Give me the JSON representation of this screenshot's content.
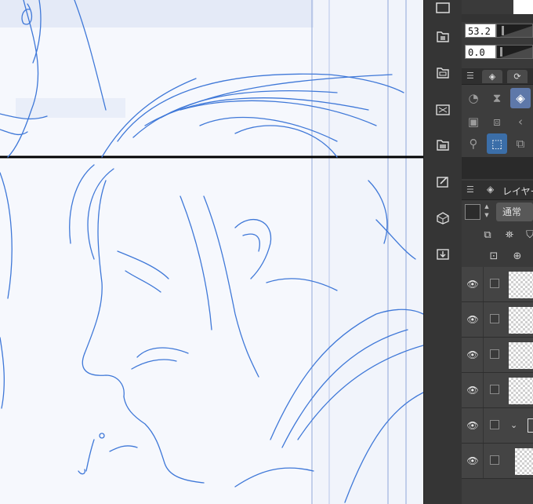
{
  "canvas": {
    "name": "drawing-canvas",
    "stroke_color": "#3f78d8",
    "ruler_color": "#000000"
  },
  "side_strip": {
    "buttons": [
      {
        "name": "navigator-icon"
      },
      {
        "name": "material-icon"
      },
      {
        "name": "layout-icon"
      },
      {
        "name": "transform-icon"
      },
      {
        "name": "image-icon"
      },
      {
        "name": "edit-icon"
      },
      {
        "name": "3d-icon"
      },
      {
        "name": "import-icon"
      }
    ]
  },
  "tool_property": {
    "field1_value": "53.2",
    "field2_value": "0.0"
  },
  "layer_panel": {
    "title": "レイヤー",
    "blend_mode": "通常",
    "layers": [
      {
        "name": "layer-1",
        "visible": true
      },
      {
        "name": "layer-2",
        "visible": true
      },
      {
        "name": "layer-3",
        "visible": true
      },
      {
        "name": "layer-4",
        "visible": true
      },
      {
        "name": "layer-folder",
        "visible": true
      },
      {
        "name": "layer-6",
        "visible": true
      }
    ]
  },
  "colors": {
    "panel_bg": "#3a3a3a",
    "active_tool": "#5e78a9",
    "selected_tool": "#3b6ea8"
  }
}
